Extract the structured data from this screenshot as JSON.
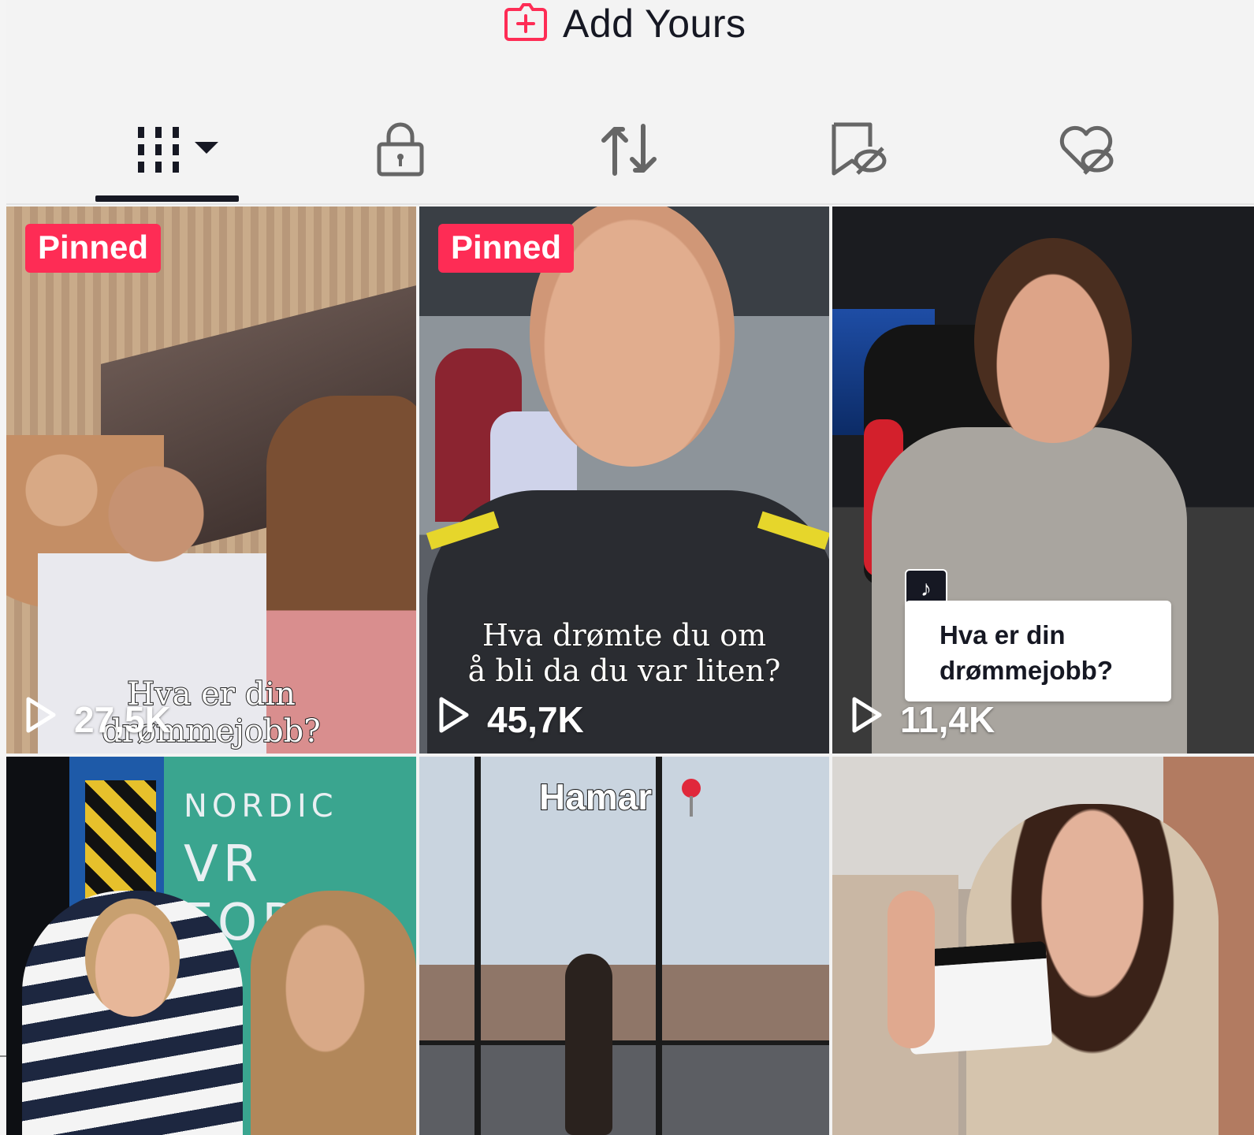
{
  "header": {
    "add_yours_label": "Add Yours",
    "add_yours_icon": "add-post-icon",
    "accent": "#fe2c55"
  },
  "tabs": [
    {
      "name": "videos",
      "icon": "grid-icon",
      "active": true
    },
    {
      "name": "private",
      "icon": "lock-icon",
      "active": false
    },
    {
      "name": "reposts",
      "icon": "repost-icon",
      "active": false
    },
    {
      "name": "favorites",
      "icon": "bookmark-hidden-icon",
      "active": false
    },
    {
      "name": "liked",
      "icon": "heart-hidden-icon",
      "active": false
    }
  ],
  "videos": [
    {
      "pinned_label": "Pinned",
      "views": "27,5K",
      "caption": "Hva er din drømmejobb?"
    },
    {
      "pinned_label": "Pinned",
      "views": "45,7K",
      "caption_line1": "Hva drømte du om",
      "caption_line2": "å bli da du var liten?"
    },
    {
      "views": "11,4K",
      "caption_line1": "Hva er din",
      "caption_line2": "drømmejobb?"
    },
    {
      "sign_line1": "NORDIC",
      "sign_line2": "VR FORU"
    },
    {
      "caption": "Hamar"
    },
    {}
  ]
}
